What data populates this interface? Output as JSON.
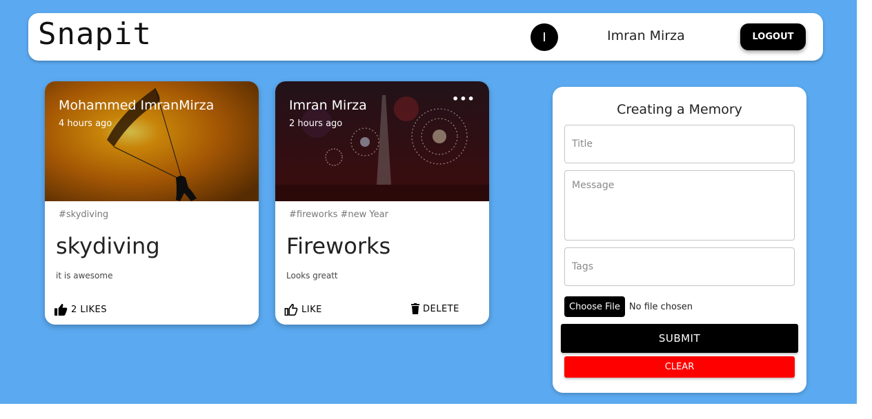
{
  "app": {
    "brand": "Snapit",
    "user_initial": "I",
    "user_name": "Imran Mirza",
    "logout_label": "LOGOUT"
  },
  "posts": [
    {
      "author": "Mohammed ImranMirza",
      "time": "4 hours ago",
      "tags": "#skydiving",
      "title": "skydiving",
      "message": "it is awesome",
      "like_label": "2 LIKES",
      "like_icon": "thumb-up-filled-icon",
      "image": "parachute-sunset"
    },
    {
      "author": "Imran Mirza",
      "time": "2 hours ago",
      "tags": "#fireworks #new Year",
      "title": "Fireworks",
      "message": "Looks greatt",
      "like_label": "LIKE",
      "like_icon": "thumb-up-outline-icon",
      "delete_label": "DELETE",
      "delete_icon": "trash-icon",
      "more_icon": "more-horizontal-icon",
      "image": "fireworks-night"
    }
  ],
  "form": {
    "heading": "Creating a Memory",
    "title_placeholder": "Title",
    "message_placeholder": "Message",
    "tags_placeholder": "Tags",
    "choose_file_label": "Choose File",
    "file_status": "No file chosen",
    "submit_label": "SUBMIT",
    "clear_label": "CLEAR"
  },
  "colors": {
    "background": "#5ba9f0",
    "clear_button": "#ff0000",
    "primary_button": "#000000"
  }
}
